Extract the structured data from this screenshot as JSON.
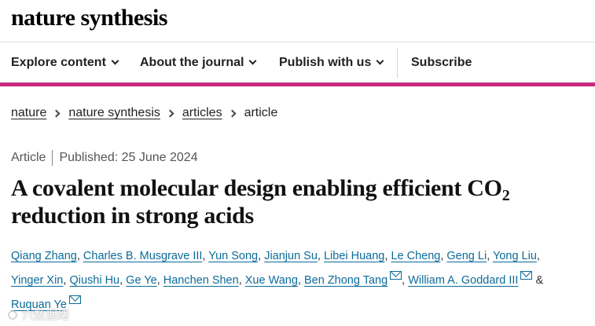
{
  "brand": {
    "logo_text": "nature synthesis"
  },
  "nav": {
    "items": [
      {
        "label": "Explore content"
      },
      {
        "label": "About the journal"
      },
      {
        "label": "Publish with us"
      }
    ],
    "subscribe": "Subscribe",
    "accent_color": "#c7297f"
  },
  "breadcrumb": {
    "items": [
      "nature",
      "nature synthesis",
      "articles"
    ],
    "current": "article"
  },
  "article": {
    "type": "Article",
    "published": "Published: 25 June 2024",
    "title_part1": "A covalent molecular design enabling efficient CO",
    "title_sub": "2",
    "title_part2": "reduction in strong acids"
  },
  "authors": {
    "list": [
      "Qiang Zhang",
      "Charles B. Musgrave III",
      "Yun Song",
      "Jianjun Su",
      "Libei Huang",
      "Le Cheng",
      "Geng Li",
      "Yong Liu",
      "Yinger Xin",
      "Qiushi Hu",
      "Ge Ye",
      "Hanchen Shen",
      "Xue Wang",
      "Ben Zhong Tang",
      "William A. Goddard III",
      "Ruquan Ye"
    ],
    "separator": ",",
    "conjunction": "&",
    "link_color": "#0b6b9a"
  },
  "watermark": {
    "text": "穴数据绪"
  }
}
